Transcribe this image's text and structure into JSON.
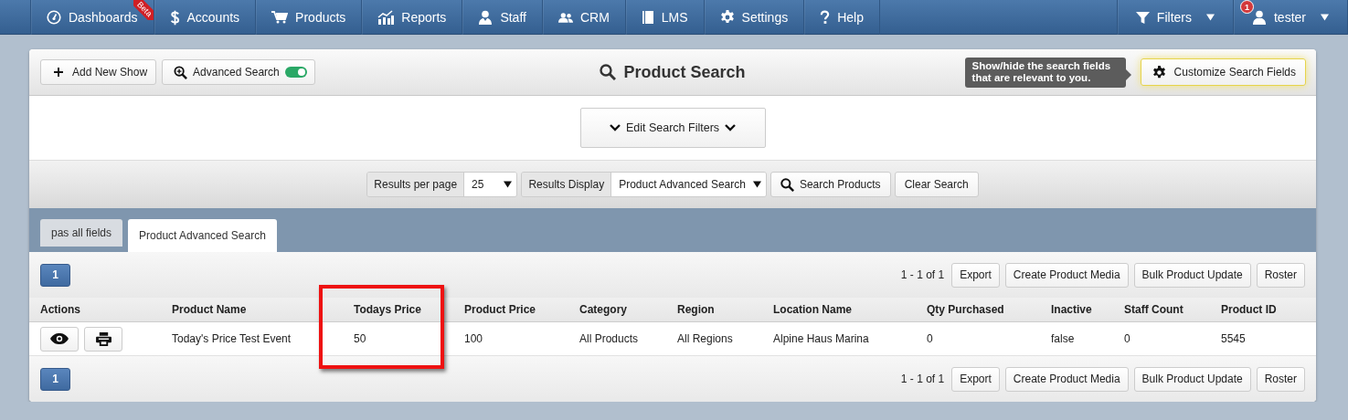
{
  "nav": {
    "left": [
      {
        "label": "Dashboards",
        "ribbon": "Beta"
      },
      {
        "label": "Accounts"
      },
      {
        "label": "Products"
      },
      {
        "label": "Reports"
      },
      {
        "label": "Staff"
      },
      {
        "label": "CRM"
      },
      {
        "label": "LMS"
      },
      {
        "label": "Settings"
      },
      {
        "label": "Help"
      }
    ],
    "right": [
      {
        "label": "Filters"
      },
      {
        "label": "tester",
        "badge": "1"
      }
    ]
  },
  "header": {
    "title": "Product Search",
    "add_button": "Add New Show",
    "advanced_search": {
      "label": "Advanced Search",
      "on": true
    },
    "tooltip": "Show/hide the search fields that are relevant to you.",
    "customize_button": "Customize Search Fields"
  },
  "edit_filters_button": "Edit Search Filters",
  "results_bar": {
    "per_page": {
      "label": "Results per page",
      "value": "25"
    },
    "display": {
      "label": "Results Display",
      "value": "Product Advanced Search"
    },
    "search_button": "Search Products",
    "clear_button": "Clear Search"
  },
  "tabs": [
    {
      "label": "pas all fields",
      "selected": false
    },
    {
      "label": "Product Advanced Search",
      "selected": true
    }
  ],
  "pager_top": {
    "page": "1",
    "range": "1 - 1 of 1",
    "buttons": [
      "Export",
      "Create Product Media",
      "Bulk Product Update",
      "Roster"
    ]
  },
  "table": {
    "columns": [
      {
        "label": "Actions",
        "highlighted": false
      },
      {
        "label": "Product Name",
        "highlighted": false
      },
      {
        "label": "Todays Price",
        "highlighted": true
      },
      {
        "label": "Product Price",
        "highlighted": false
      },
      {
        "label": "Category",
        "highlighted": false
      },
      {
        "label": "Region",
        "highlighted": false
      },
      {
        "label": "Location Name",
        "highlighted": false
      },
      {
        "label": "Qty Purchased",
        "highlighted": false
      },
      {
        "label": "Inactive",
        "highlighted": false
      },
      {
        "label": "Staff Count",
        "highlighted": false
      },
      {
        "label": "Product ID",
        "highlighted": false
      }
    ],
    "rows": [
      {
        "cells": [
          "",
          "Today's Price Test Event",
          "50",
          "100",
          "All Products",
          "All Regions",
          "Alpine Haus Marina",
          "0",
          "false",
          "0",
          "5545"
        ]
      }
    ]
  },
  "pager_bottom": {
    "page": "1",
    "range": "1 - 1 of 1",
    "buttons": [
      "Export",
      "Create Product Media",
      "Bulk Product Update",
      "Roster"
    ]
  }
}
